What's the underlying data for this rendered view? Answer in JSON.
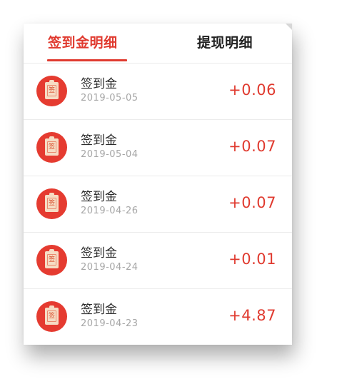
{
  "tabs": [
    {
      "label": "签到金明细",
      "active": true
    },
    {
      "label": "提现明细",
      "active": false
    }
  ],
  "records": [
    {
      "icon": "sign-in-clipboard-icon",
      "icon_label": "签",
      "title": "签到金",
      "date": "2019-05-05",
      "amount": "+0.06"
    },
    {
      "icon": "sign-in-clipboard-icon",
      "icon_label": "签",
      "title": "签到金",
      "date": "2019-05-04",
      "amount": "+0.07"
    },
    {
      "icon": "sign-in-clipboard-icon",
      "icon_label": "签",
      "title": "签到金",
      "date": "2019-04-26",
      "amount": "+0.07"
    },
    {
      "icon": "sign-in-clipboard-icon",
      "icon_label": "签",
      "title": "签到金",
      "date": "2019-04-24",
      "amount": "+0.01"
    },
    {
      "icon": "sign-in-clipboard-icon",
      "icon_label": "签",
      "title": "签到金",
      "date": "2019-04-23",
      "amount": "+4.87"
    }
  ],
  "colors": {
    "accent": "#e03a2f",
    "icon_bg": "#e53b30",
    "text": "#222222",
    "muted": "#a6a6a6"
  }
}
